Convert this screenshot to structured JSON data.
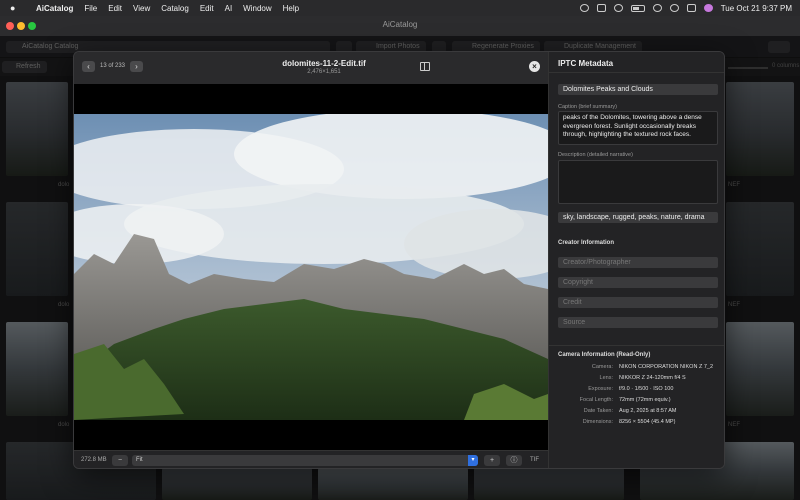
{
  "menubar": {
    "app": "AiCatalog",
    "items": [
      "File",
      "Edit",
      "View",
      "Catalog",
      "Edit",
      "AI",
      "Window",
      "Help"
    ],
    "clock": "Tue Oct 21  9:37 PM"
  },
  "window": {
    "title": "AiCatalog"
  },
  "toolbar": {
    "catalog": "AiCatalog Catalog",
    "import": "Import Photos",
    "regenerate": "Regenerate Proxies",
    "duplicate": "Duplicate Management",
    "refresh": "Refresh",
    "count": "0 columns"
  },
  "grid": {
    "labels": [
      "dolo",
      "dolo",
      "dolo",
      "NEF",
      "NEF",
      "NEF"
    ]
  },
  "preview": {
    "position": "13 of 233",
    "filename": "dolomites-11-2-Edit.tif",
    "dimensions": "2,476×1,651",
    "filesize": "272.8 MB",
    "zoom": "Fit",
    "format": "TIF"
  },
  "iptc": {
    "title": "IPTC Metadata",
    "headline": "Dolomites Peaks and Clouds",
    "caption_label": "Caption (brief summary)",
    "caption": "peaks of the Dolomites, towering above a dense evergreen forest. Sunlight occasionally breaks through, highlighting the textured rock faces.",
    "description_label": "Description (detailed narrative)",
    "description": "",
    "keywords": "sky, landscape, rugged, peaks, nature, drama",
    "creator_section": "Creator Information",
    "creator_placeholder": "Creator/Photographer",
    "copyright_placeholder": "Copyright",
    "credit_placeholder": "Credit",
    "source_placeholder": "Source",
    "camera_section": "Camera Information (Read-Only)",
    "camera": [
      {
        "label": "Camera:",
        "value": "NIKON CORPORATION NIKON Z 7_2"
      },
      {
        "label": "Lens:",
        "value": "NIKKOR Z 24-120mm f/4 S"
      },
      {
        "label": "Exposure:",
        "value": "f/9.0 · 1/500 · ISO 100"
      },
      {
        "label": "Focal Length:",
        "value": "72mm (72mm equiv.)"
      },
      {
        "label": "Date Taken:",
        "value": "Aug 2, 2025 at 8:57 AM"
      },
      {
        "label": "Dimensions:",
        "value": "8256 × 5504 (45.4 MP)"
      }
    ]
  }
}
